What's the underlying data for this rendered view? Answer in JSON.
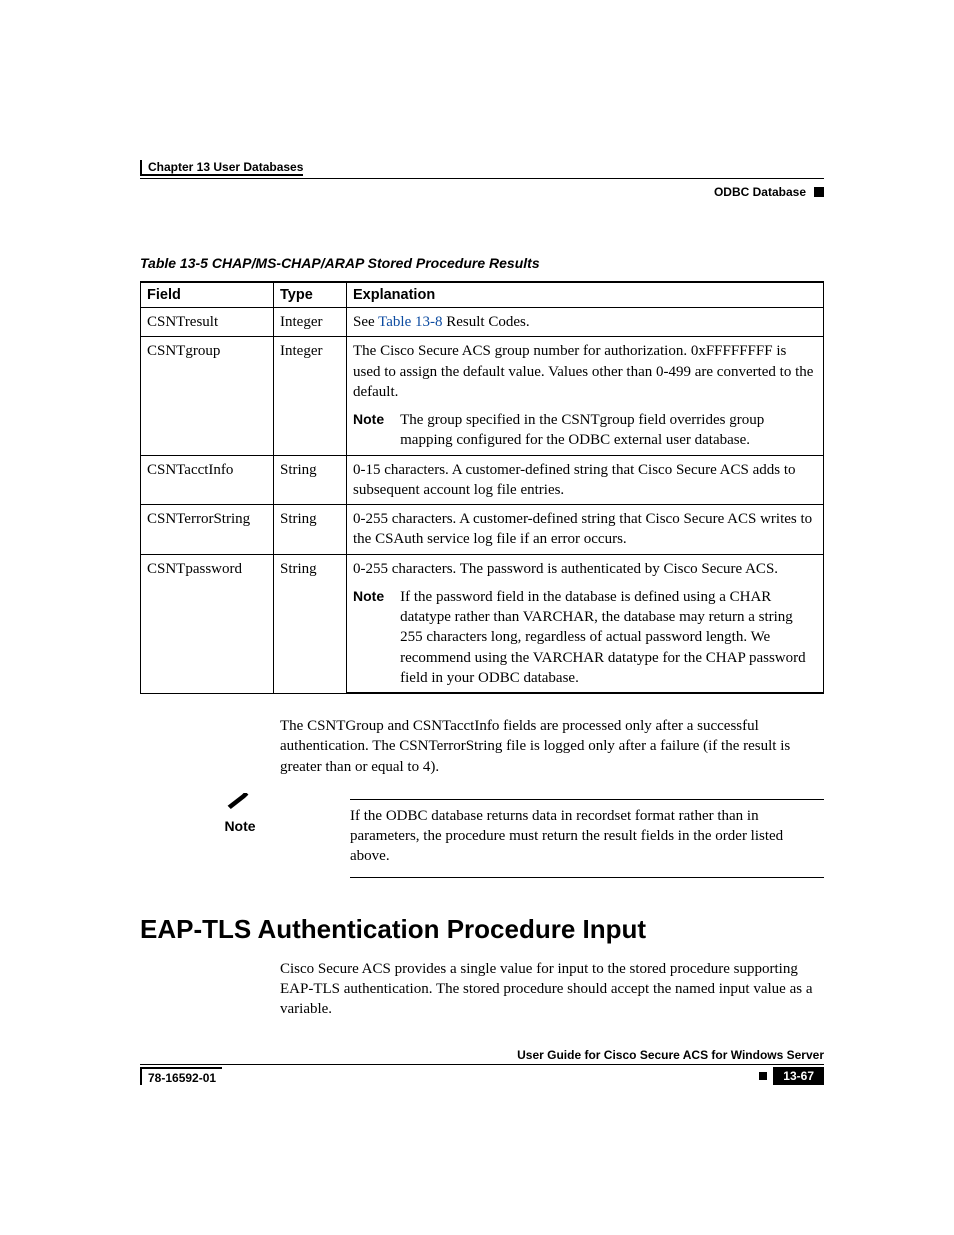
{
  "header": {
    "chapter": "Chapter 13    User Databases",
    "section": "ODBC Database"
  },
  "table": {
    "caption": "Table 13-5   CHAP/MS-CHAP/ARAP Stored Procedure Results",
    "headers": {
      "field": "Field",
      "type": "Type",
      "explanation": "Explanation"
    },
    "rows": [
      {
        "field": "CSNTresult",
        "type": "Integer",
        "explanation_prefix": "See ",
        "explanation_link": "Table 13-8",
        "explanation_suffix": " Result Codes."
      },
      {
        "field": "CSNTgroup",
        "type": "Integer",
        "explanation": "The Cisco Secure ACS group number for authorization. 0xFFFFFFFF is used to assign the default value. Values other than 0-499 are converted to the default.",
        "note_label": "Note",
        "note_text": "The group specified in the CSNTgroup field overrides group mapping configured for the ODBC external user database."
      },
      {
        "field": "CSNTacctInfo",
        "type": "String",
        "explanation": "0-15 characters. A customer-defined string that Cisco Secure ACS adds to subsequent account log file entries."
      },
      {
        "field": "CSNTerrorString",
        "type": "String",
        "explanation": "0-255 characters. A customer-defined string that Cisco Secure ACS writes to the CSAuth service log file if an error occurs."
      },
      {
        "field": "CSNTpassword",
        "type": "String",
        "explanation": "0-255 characters. The password is authenticated by Cisco Secure ACS.",
        "note_label": "Note",
        "note_text": "If the password field in the database is defined using a CHAR datatype rather than VARCHAR, the database may return a string 255 characters long, regardless of actual password length. We recommend using the VARCHAR datatype for the CHAP password field in your ODBC database."
      }
    ]
  },
  "paragraph1": "The CSNTGroup and CSNTacctInfo fields are processed only after a successful authentication. The CSNTerrorString file is logged only after a failure (if the result is greater than or equal to 4).",
  "callout": {
    "label": "Note",
    "text": "If the ODBC database returns data in recordset format rather than in parameters, the procedure must return the result fields in the order listed above."
  },
  "section_heading": "EAP-TLS Authentication Procedure Input",
  "paragraph2": "Cisco Secure ACS provides a single value for input to the stored procedure supporting EAP-TLS authentication. The stored procedure should accept the named input value as a variable.",
  "footer": {
    "book": "User Guide for Cisco Secure ACS for Windows Server",
    "docnum": "78-16592-01",
    "page": "13-67"
  }
}
